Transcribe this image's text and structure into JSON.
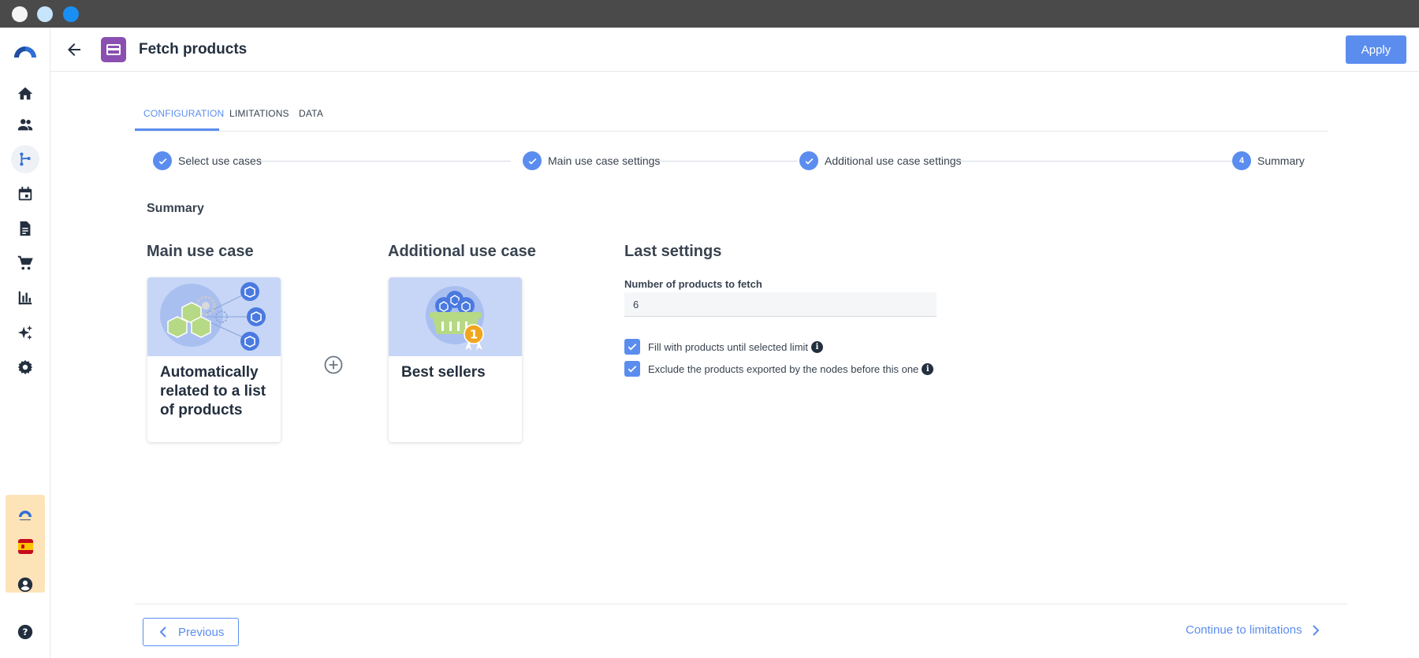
{
  "header": {
    "title": "Fetch products",
    "apply_label": "Apply"
  },
  "tabs": [
    {
      "label": "CONFIGURATION",
      "active": true
    },
    {
      "label": "LIMITATIONS",
      "active": false
    },
    {
      "label": "DATA",
      "active": false
    }
  ],
  "stepper": [
    {
      "number": "",
      "label": "Select use cases",
      "done": true
    },
    {
      "number": "",
      "label": "Main use case settings",
      "done": true
    },
    {
      "number": "",
      "label": "Additional use case settings",
      "done": true
    },
    {
      "number": "4",
      "label": "Summary",
      "done": false
    }
  ],
  "summary": {
    "title": "Summary",
    "main_use_case": {
      "heading": "Main use case",
      "card_label": "Automatically related to a list of products"
    },
    "additional_use_case": {
      "heading": "Additional use case",
      "card_label": "Best sellers"
    },
    "last_settings": {
      "heading": "Last settings",
      "products_label": "Number of products to fetch",
      "products_value": "6",
      "fill_label": "Fill with products until selected limit",
      "fill_checked": true,
      "exclude_label": "Exclude the products exported by the nodes before this one",
      "exclude_checked": true
    }
  },
  "footer": {
    "previous_label": "Previous",
    "next_label": "Continue to limitations"
  },
  "sidebar_icons": [
    "home-icon",
    "users-icon",
    "workflow-icon",
    "calendar-icon",
    "document-icon",
    "cart-icon",
    "chart-icon",
    "sparkles-icon",
    "gear-icon"
  ],
  "colors": {
    "accent": "#5b8def",
    "node": "#8a4fb0",
    "titlebar": "#4a4a4a",
    "card_illustration": "#c7d6f7"
  }
}
